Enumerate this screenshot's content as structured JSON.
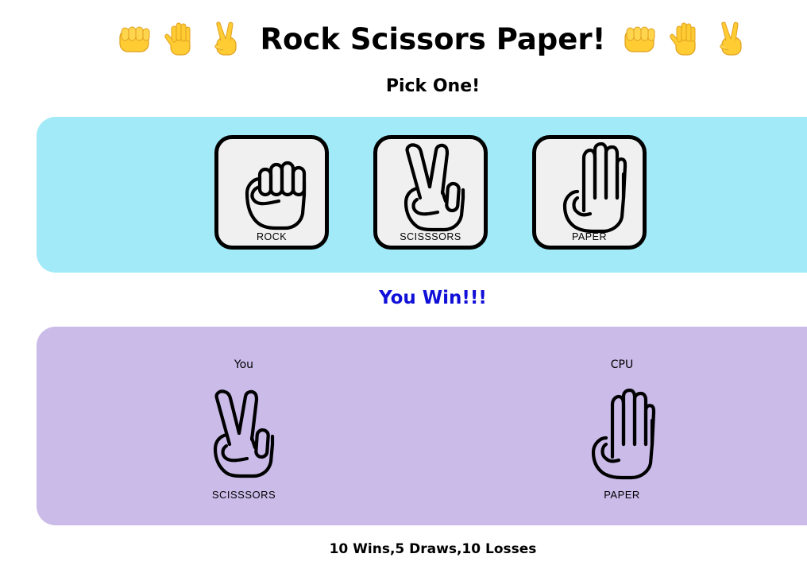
{
  "header": {
    "title": "Rock Scissors Paper!",
    "left_emojis": [
      "fist-emoji",
      "raised-hand-emoji",
      "victory-hand-emoji"
    ],
    "right_emojis": [
      "fist-emoji",
      "raised-hand-emoji",
      "victory-hand-emoji"
    ]
  },
  "prompt": "Pick One!",
  "choices": [
    {
      "id": "rock",
      "label": "ROCK",
      "icon": "rock-hand-icon"
    },
    {
      "id": "scissors",
      "label": "SCISSSORS",
      "icon": "scissors-hand-icon"
    },
    {
      "id": "paper",
      "label": "PAPER",
      "icon": "paper-hand-icon"
    }
  ],
  "result": {
    "text": "You Win!!!",
    "color": "#1010d8"
  },
  "battle": {
    "player": {
      "name": "You",
      "choice_label": "SCISSSORS",
      "icon": "scissors-hand-icon"
    },
    "cpu": {
      "name": "CPU",
      "choice_label": "PAPER",
      "icon": "paper-hand-icon"
    }
  },
  "score": {
    "text": "10 Wins,5 Draws,10 Losses"
  },
  "colors": {
    "choices_panel": "#a2eaf8",
    "battle_panel": "#cbbbe9",
    "card_bg": "#f0f0f0",
    "emoji_yellow": "#ffcc33"
  }
}
